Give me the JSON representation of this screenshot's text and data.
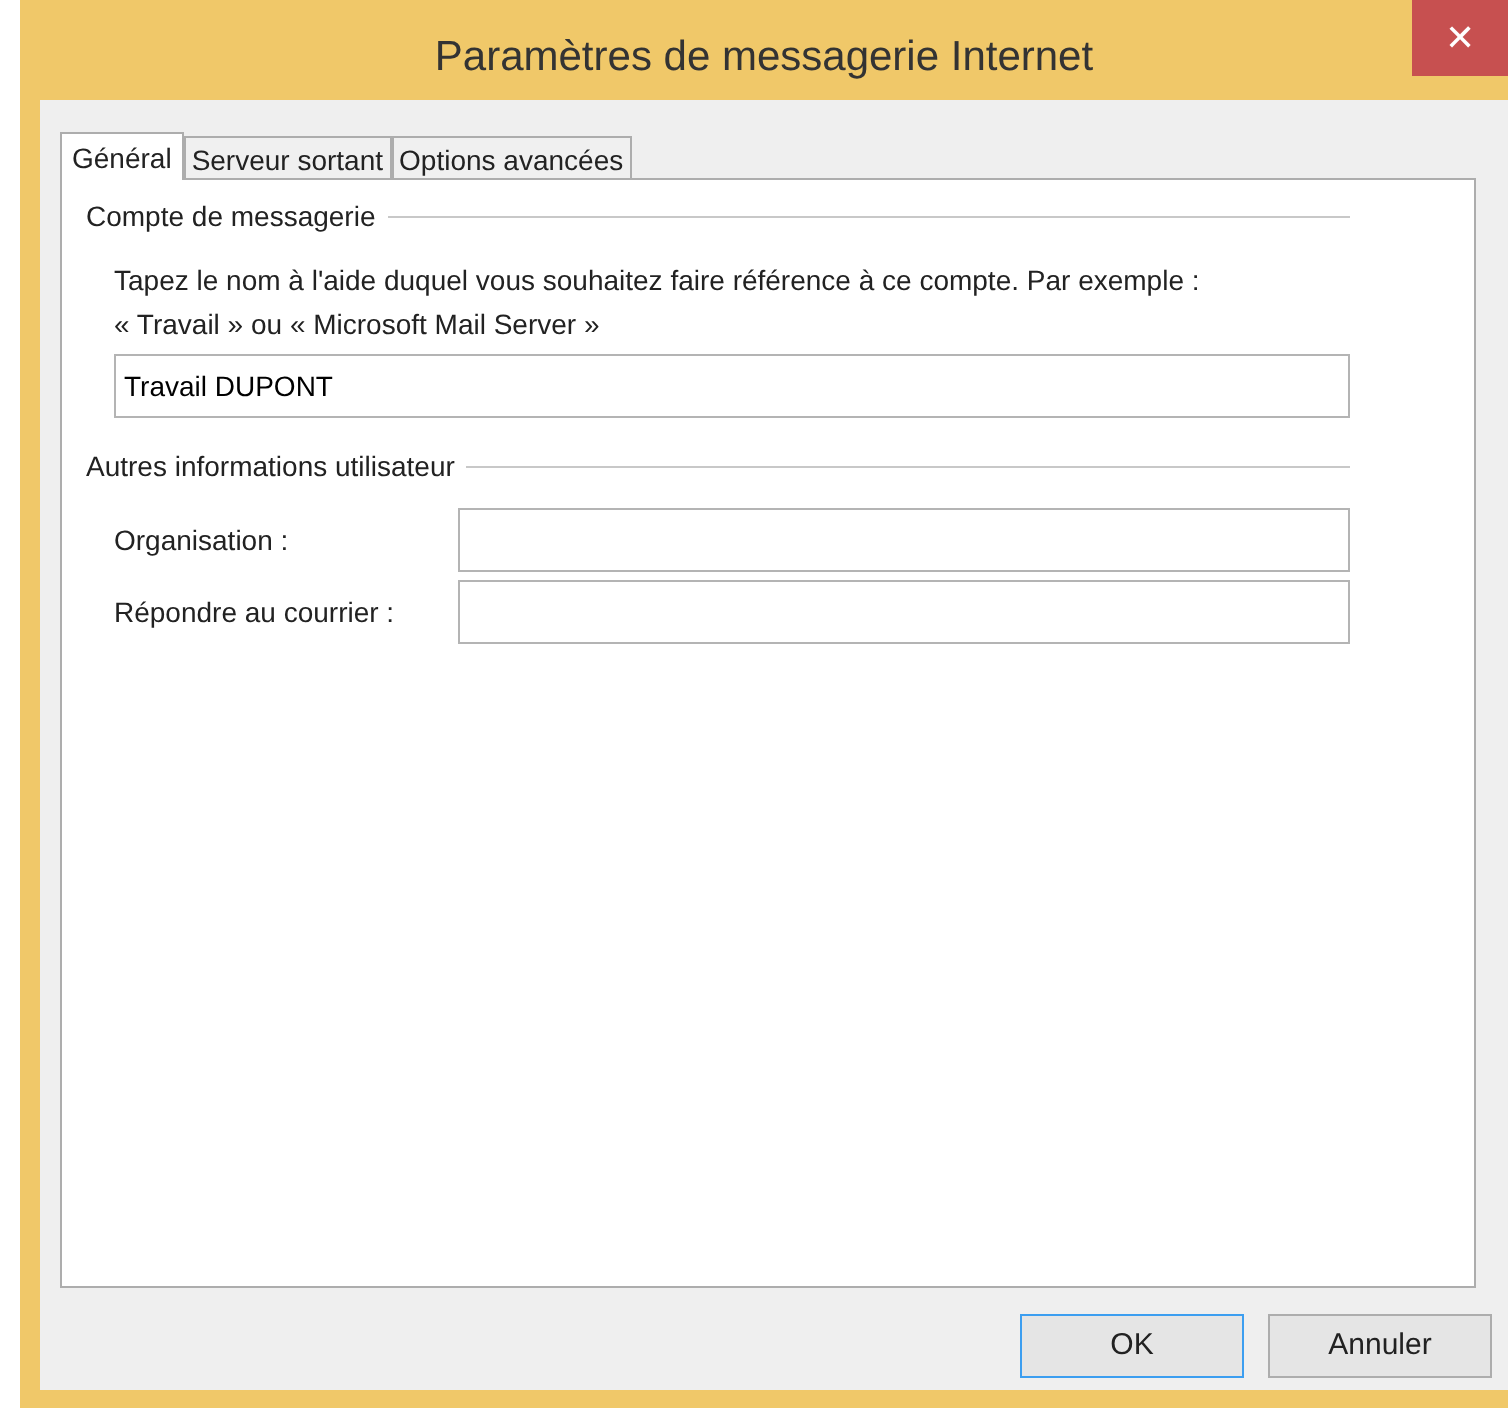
{
  "window": {
    "title": "Paramètres de messagerie Internet",
    "close": "✕"
  },
  "tabs": [
    {
      "label": "Général",
      "selected": true
    },
    {
      "label": "Serveur sortant",
      "selected": false
    },
    {
      "label": "Options avancées",
      "selected": false
    }
  ],
  "account_group": {
    "title": "Compte de messagerie",
    "description": "Tapez le nom à l'aide duquel vous souhaitez faire référence à ce compte. Par exemple :\n« Travail » ou « Microsoft Mail Server »",
    "value": "Travail DUPONT"
  },
  "user_group": {
    "title": "Autres informations utilisateur",
    "fields": [
      {
        "label": "Organisation :"
      },
      {
        "label": "Répondre au courrier :"
      }
    ]
  },
  "buttons": [
    {
      "label": "OK",
      "default": true
    },
    {
      "label": "Annuler",
      "default": false
    }
  ]
}
